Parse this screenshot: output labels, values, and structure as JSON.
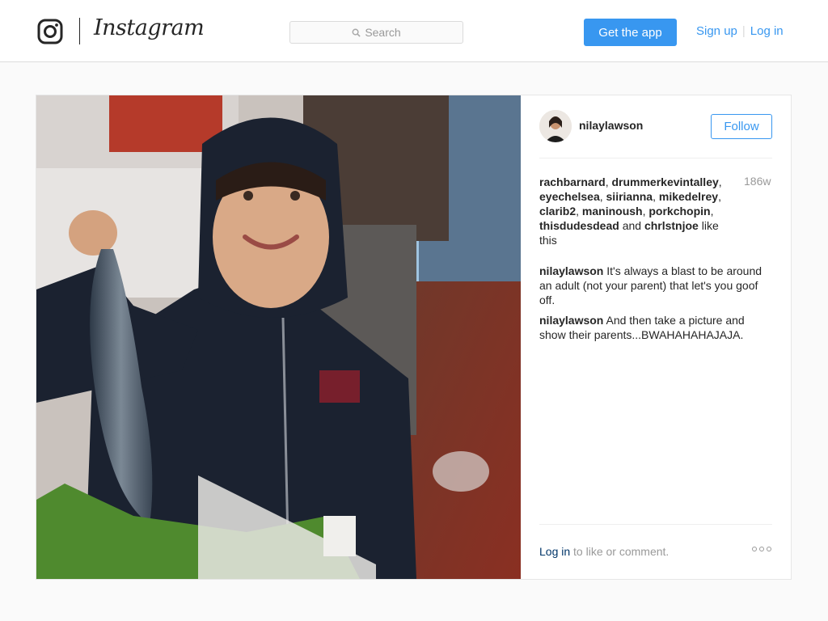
{
  "header": {
    "logo_icon": "instagram-camera-icon",
    "wordmark": "Instagram",
    "search": {
      "icon": "search-icon",
      "placeholder": "Search"
    },
    "get_app_label": "Get the app",
    "sign_up_label": "Sign up",
    "separator": "|",
    "log_in_label": "Log in"
  },
  "post": {
    "photo_icon": "post-photo",
    "author": {
      "username": "nilaylawson",
      "avatar_icon": "avatar"
    },
    "follow_label": "Follow",
    "likes": {
      "users": [
        "rachbarnard",
        "drummerkevintalley",
        "eyechelsea",
        "siirianna",
        "mikedelrey",
        "clarib2",
        "maninoush",
        "porkchopin",
        "thisdudesdead",
        "chrlstnjoe"
      ],
      "and_word": "and",
      "suffix": "like this"
    },
    "time_ago": "186w",
    "comments": [
      {
        "user": "nilaylawson",
        "text": "It's always a blast to be around an adult (not your parent) that let's you goof off."
      },
      {
        "user": "nilaylawson",
        "text": "And then take a picture and show their parents...BWAHAHAHAJAJA."
      }
    ],
    "footer": {
      "log_in_link": "Log in",
      "prompt": "to like or comment.",
      "more_icon": "more-options-icon"
    }
  },
  "colors": {
    "accent": "#3897f0",
    "link_dark": "#003569",
    "muted": "#999999",
    "border": "#dbdbdb",
    "background": "#fafafa"
  }
}
